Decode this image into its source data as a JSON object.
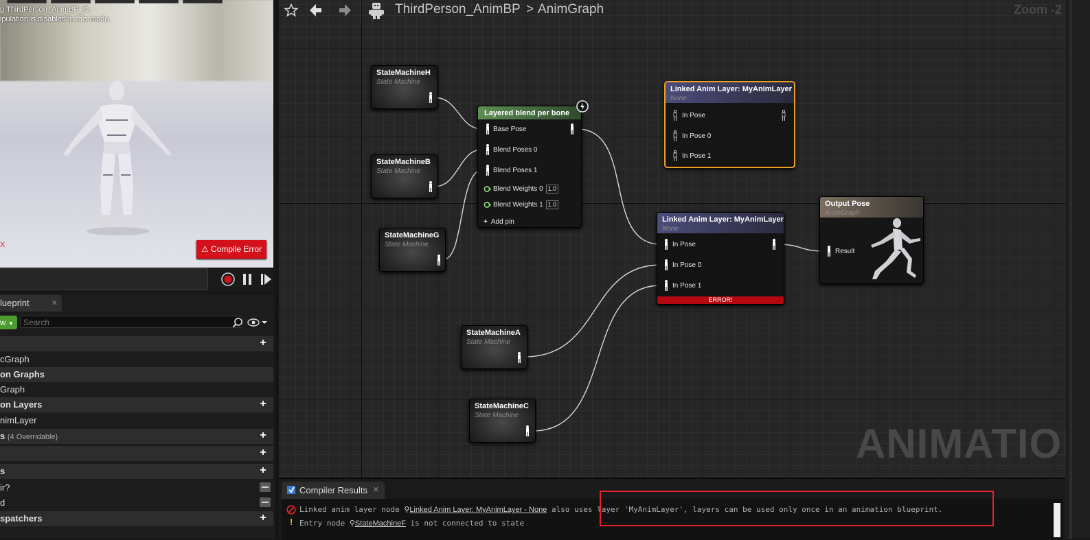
{
  "viewport": {
    "info_line1": "g ThirdPerson_AnimBP_C.",
    "info_line2": "ipulation is disabled in this mode.",
    "compile_error": "Compile Error",
    "x_mark": "X"
  },
  "blueprint_panel": {
    "tab_label": "lueprint",
    "add_label": "w",
    "search_placeholder": "Search",
    "rows": [
      {
        "label": "",
        "type": "hdr"
      },
      {
        "label": "cGraph",
        "type": "item"
      },
      {
        "label": "on Graphs",
        "type": "hdr"
      },
      {
        "label": "Graph",
        "type": "item"
      },
      {
        "label": "on Layers",
        "type": "hdr"
      },
      {
        "label": "nimLayer",
        "type": "item"
      },
      {
        "label": "s",
        "sub": "(4 Overridable)",
        "type": "hdr"
      },
      {
        "label": "",
        "type": "hdr"
      },
      {
        "label": "s",
        "type": "hdr"
      },
      {
        "label": "ir?",
        "type": "item"
      },
      {
        "label": "d",
        "type": "item"
      },
      {
        "label": "spatchers",
        "type": "hdr"
      }
    ]
  },
  "graph": {
    "breadcrumb_bp": "ThirdPerson_AnimBP",
    "breadcrumb_sep": ">",
    "breadcrumb_graph": "AnimGraph",
    "zoom": "Zoom -2",
    "watermark": "ANIMATION",
    "state_machine_subtitle": "State Machine",
    "nodes": {
      "smH": "StateMachineH",
      "smB": "StateMachineB",
      "smG": "StateMachineG",
      "smA": "StateMachineA",
      "smC": "StateMachineC",
      "layered": {
        "title": "Layered blend per bone",
        "pins": [
          "Base Pose",
          "Blend Poses 0",
          "Blend Poses 1",
          "Blend Weights 0",
          "Blend Weights 1"
        ],
        "weight_values": [
          "1.0",
          "1.0"
        ],
        "add_pin": "Add pin"
      },
      "linked_top": {
        "title": "Linked Anim Layer: MyAnimLayer",
        "subtitle": "None",
        "pins": [
          "In Pose",
          "In Pose 0",
          "In Pose 1"
        ]
      },
      "linked_mid": {
        "title": "Linked Anim Layer: MyAnimLayer",
        "subtitle": "None",
        "pins": [
          "In Pose",
          "In Pose 0",
          "In Pose 1"
        ],
        "error": "ERROR!"
      },
      "output": {
        "title": "Output Pose",
        "subtitle": "AnimGraph",
        "pin": "Result"
      }
    }
  },
  "compiler": {
    "tab_label": "Compiler Results",
    "msg1_pre": "Linked anim layer node",
    "msg1_link": "Linked Anim Layer: MyAnimLayer - None",
    "msg1_post": "also uses layer 'MyAnimLayer', layers can be used only once in an animation blueprint.",
    "msg2_pre": "Entry node",
    "msg2_link": "StateMachineF",
    "msg2_post": "is not connected to state"
  },
  "colors": {
    "error_red": "#d4101a",
    "selected_orange": "#f0a020",
    "highlight_box": "#e8202a"
  }
}
